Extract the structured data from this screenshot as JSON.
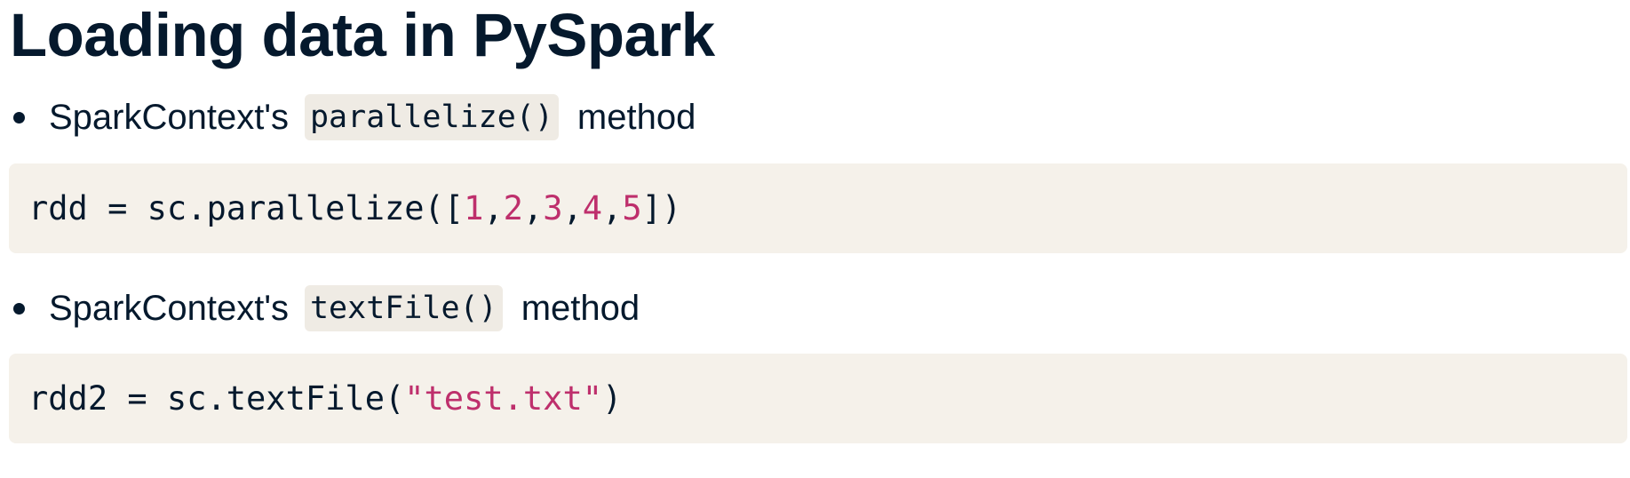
{
  "title": "Loading data in PySpark",
  "bullets": [
    {
      "prefix": "SparkContext's",
      "code": "parallelize()",
      "suffix": "method"
    },
    {
      "prefix": "SparkContext's",
      "code": "textFile()",
      "suffix": "method"
    }
  ],
  "code_blocks": [
    {
      "before": "rdd = sc.parallelize([",
      "nums": [
        "1",
        "2",
        "3",
        "4",
        "5"
      ],
      "sep": ",",
      "after": "])"
    },
    {
      "before": "rdd2 = sc.textFile(",
      "string": "\"test.txt\"",
      "after": ")"
    }
  ],
  "colors": {
    "heading": "#05192d",
    "code_bg": "#f5f1ea",
    "inline_code_bg": "#efebe4",
    "literal": "#be2f6c"
  }
}
